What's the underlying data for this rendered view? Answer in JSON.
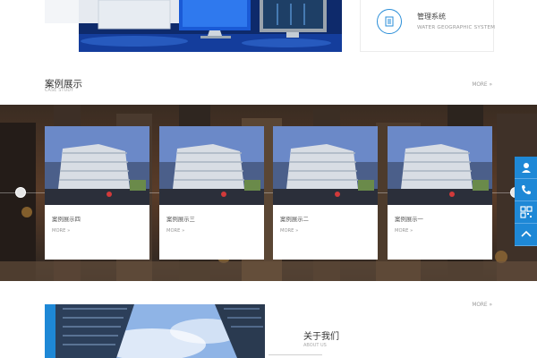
{
  "management_card": {
    "title": "管理系统",
    "subtitle": "WATER GEOGRAPHIC SYSTEM",
    "icon": "document-icon"
  },
  "case_section": {
    "title": "案例展示",
    "subtitle": "CASE STUDY",
    "more": "MORE »",
    "cards": [
      {
        "name": "案例展示四",
        "more": "MORE »"
      },
      {
        "name": "案例展示三",
        "more": "MORE »"
      },
      {
        "name": "案例展示二",
        "more": "MORE »"
      },
      {
        "name": "案例展示一",
        "more": "MORE »"
      }
    ]
  },
  "about_section": {
    "title": "关于我们",
    "subtitle": "ABOUT US",
    "more": "MORE »"
  },
  "sidebar": {
    "items": [
      "user-service-icon",
      "phone-icon",
      "qr-code-icon",
      "back-to-top-icon"
    ]
  },
  "colors": {
    "accent": "#1e88d6",
    "text": "#333333",
    "muted": "#999999"
  }
}
